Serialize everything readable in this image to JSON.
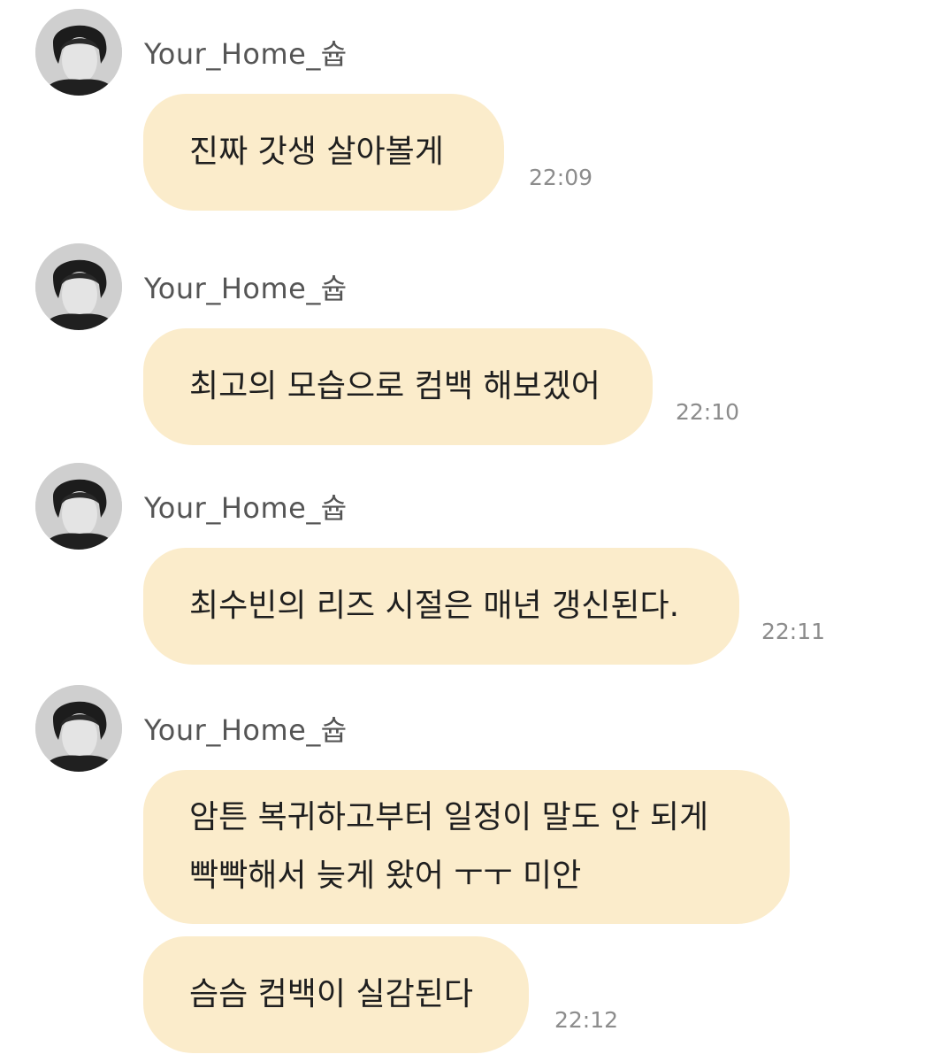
{
  "colors": {
    "bubble": "#fbeccb",
    "background": "#ffffff",
    "sender_text": "#555555",
    "time_text": "#8c8c8c"
  },
  "messages": [
    {
      "avatar_icon": "profile-photo-avatar",
      "sender": "Your_Home_슙",
      "bubbles": [
        {
          "lines": [
            "진짜 갓생 살아볼게"
          ]
        }
      ],
      "time": "22:09"
    },
    {
      "avatar_icon": "profile-photo-avatar",
      "sender": "Your_Home_슙",
      "bubbles": [
        {
          "lines": [
            "최고의 모습으로 컴백 해보겠어"
          ]
        }
      ],
      "time": "22:10"
    },
    {
      "avatar_icon": "profile-photo-avatar",
      "sender": "Your_Home_슙",
      "bubbles": [
        {
          "lines": [
            "최수빈의 리즈 시절은 매년 갱신된다."
          ]
        }
      ],
      "time": "22:11"
    },
    {
      "avatar_icon": "profile-photo-avatar",
      "sender": "Your_Home_슙",
      "bubbles": [
        {
          "lines": [
            "암튼 복귀하고부터 일정이 말도 안 되게",
            "빡빡해서 늦게 왔어 ㅜㅜ 미안"
          ]
        },
        {
          "lines": [
            "슴슴 컴백이 실감된다"
          ]
        }
      ],
      "time": "22:12"
    }
  ]
}
